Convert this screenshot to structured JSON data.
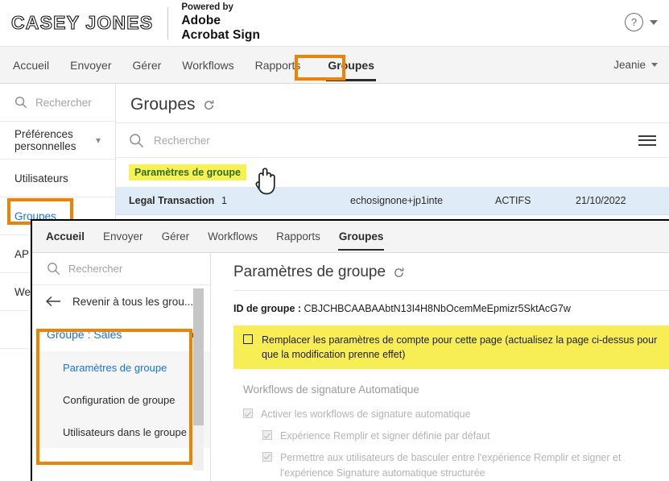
{
  "header": {
    "brand": "CASEY JONES",
    "powered_by": "Powered by",
    "product_line1": "Adobe",
    "product_line2": "Acrobat Sign",
    "help_icon": "help-circle-icon",
    "help_caret_icon": "chevron-down-icon"
  },
  "bg_nav": {
    "tabs": [
      {
        "label": "Accueil",
        "active": false
      },
      {
        "label": "Envoyer",
        "active": false
      },
      {
        "label": "Gérer",
        "active": false
      },
      {
        "label": "Workflows",
        "active": false
      },
      {
        "label": "Rapports",
        "active": false
      },
      {
        "label": "Groupes",
        "active": true
      }
    ],
    "user": "Jeanie",
    "user_caret_icon": "chevron-down-icon"
  },
  "bg_sidebar": {
    "search_placeholder": "Rechercher",
    "search_icon": "search-icon",
    "items": [
      {
        "label": "Préférences personnelles",
        "chevron": "˅",
        "link": false
      },
      {
        "label": "Utilisateurs",
        "link": false
      },
      {
        "label": "Groupes",
        "link": true
      },
      {
        "label": "AP",
        "link": false
      },
      {
        "label": "We",
        "link": false
      }
    ]
  },
  "bg_main": {
    "title": "Groupes",
    "refresh_icon": "refresh-icon",
    "search_placeholder": "Rechercher",
    "search_icon": "search-icon",
    "menu_icon": "hamburger-menu-icon",
    "tooltip": "Paramètres de groupe",
    "row": {
      "name": "Legal Transaction",
      "count": "1",
      "email": "echosignone+jp1inte",
      "status": "ACTIFS",
      "date": "21/10/2022"
    }
  },
  "fg_nav": {
    "tabs": [
      {
        "label": "Accueil",
        "active": false
      },
      {
        "label": "Envoyer",
        "active": false
      },
      {
        "label": "Gérer",
        "active": false
      },
      {
        "label": "Workflows",
        "active": false
      },
      {
        "label": "Rapports",
        "active": false
      },
      {
        "label": "Groupes",
        "active": true
      }
    ]
  },
  "fg_sidebar": {
    "search_placeholder": "Rechercher",
    "search_icon": "search-icon",
    "back_label": "Revenir à tous les grou...",
    "back_icon": "arrow-left-icon",
    "group_header": "Groupe : Sales",
    "group_caret_icon": "chevron-up-icon",
    "sub_items": [
      {
        "label": "Paramètres de groupe",
        "selected": true
      },
      {
        "label": "Configuration de groupe",
        "selected": false
      },
      {
        "label": "Utilisateurs dans le groupe",
        "selected": false
      }
    ],
    "scroll_up_icon": "chevron-up-icon"
  },
  "fg_main": {
    "title": "Paramètres de groupe",
    "refresh_icon": "refresh-icon",
    "group_id_label": "ID de groupe :",
    "group_id_value": "CBJCHBCAABAAbtN13I4H8NbOcemMeEpmizr5SktAcG7w",
    "banner_text": "Remplacer les paramètres de compte pour cette page (actualisez la page ci-dessus pour que la modification prenne effet)",
    "section_title": "Workflows de signature Automatique",
    "options": [
      {
        "label": "Activer les workflows de signature automatique",
        "indent": false,
        "checked": true
      },
      {
        "label": "Expérience Remplir et signer définie par défaut",
        "indent": true,
        "checked": true
      },
      {
        "label": "Permettre aux utilisateurs de basculer entre l'expérience Remplir et signer et l'expérience Signature automatique structurée",
        "indent": true,
        "checked": true
      }
    ]
  },
  "annotations": {
    "color": "#ef8200",
    "highlight_color": "#f7ed55"
  }
}
